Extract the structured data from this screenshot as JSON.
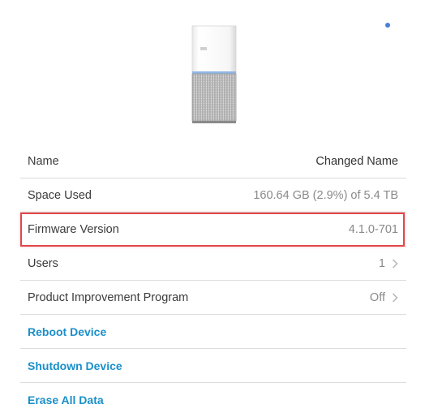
{
  "colors": {
    "status_dot": "#4a7fd6",
    "action": "#1a8fc9",
    "highlight": "#e0484b"
  },
  "device": {
    "icon": "nas-drive-image"
  },
  "rows": [
    {
      "label": "Name",
      "value": "Changed Name"
    },
    {
      "label": "Space Used",
      "value": "160.64 GB (2.9%) of 5.4 TB"
    },
    {
      "label": "Firmware Version",
      "value": "4.1.0-701"
    },
    {
      "label": "Users",
      "value": "1"
    },
    {
      "label": "Product Improvement Program",
      "value": "Off"
    }
  ],
  "actions": {
    "reboot": "Reboot Device",
    "shutdown": "Shutdown Device",
    "erase": "Erase All Data"
  }
}
